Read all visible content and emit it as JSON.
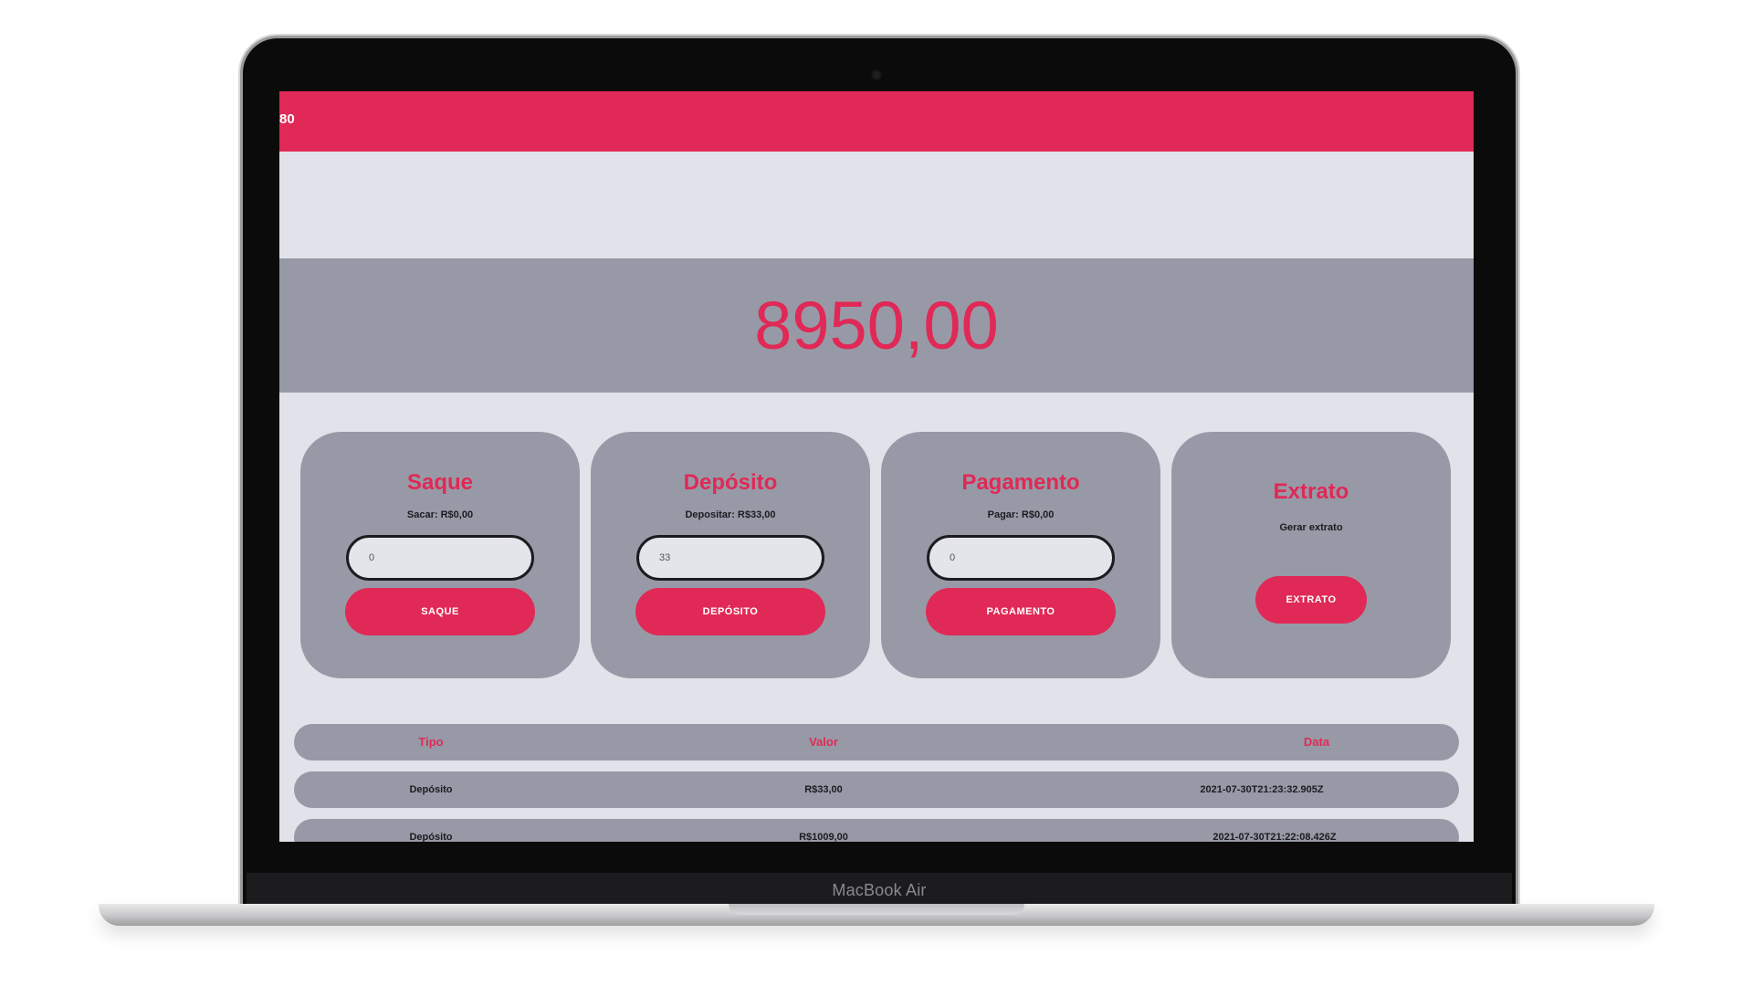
{
  "device": {
    "brand": "MacBook Air"
  },
  "app": {
    "header_title": "80",
    "balance": "8950,00"
  },
  "cards": [
    {
      "title": "Saque",
      "subtitle": "Sacar: R$0,00",
      "input_value": "0",
      "button": "SAQUE"
    },
    {
      "title": "Depósito",
      "subtitle": "Depositar: R$33,00",
      "input_value": "33",
      "button": "DEPÓSITO"
    },
    {
      "title": "Pagamento",
      "subtitle": "Pagar: R$0,00",
      "input_value": "0",
      "button": "PAGAMENTO"
    },
    {
      "title": "Extrato",
      "subtitle": "Gerar extrato",
      "button": "EXTRATO"
    }
  ],
  "table": {
    "headers": [
      "Tipo",
      "Valor",
      "Data"
    ],
    "rows": [
      [
        "Depósito",
        "R$33,00",
        "2021-07-30T21:23:32.905Z"
      ],
      [
        "Depósito",
        "R$1009,00",
        "2021-07-30T21:22:08.426Z"
      ]
    ]
  },
  "colors": {
    "accent": "#e02956",
    "panel": "#979aa6",
    "background": "#e1e2ea"
  }
}
